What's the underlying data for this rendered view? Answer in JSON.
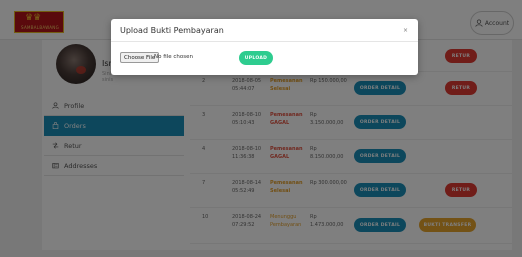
{
  "header": {
    "logo_text": "SAMBALBAWANG",
    "account_label": "Account"
  },
  "profile": {
    "name": "Isn",
    "meta_line1": "Sini",
    "meta_line2": "sinis"
  },
  "sidebar": {
    "items": [
      {
        "label": "Profile",
        "icon": "user-icon",
        "active": false
      },
      {
        "label": "Orders",
        "icon": "bag-icon",
        "active": true
      },
      {
        "label": "Retur",
        "icon": "return-icon",
        "active": false
      },
      {
        "label": "Addresses",
        "icon": "address-icon",
        "active": false
      }
    ]
  },
  "orders": {
    "rows": [
      {
        "no": "",
        "date": "",
        "status": "",
        "total": "",
        "detail": "",
        "action": "RETUR"
      },
      {
        "no": "2",
        "date": "2018-08-05 05:44:07",
        "status": "Pemesanan Selesai",
        "status_color": "orange",
        "total": "Rp 150.000,00",
        "detail": "ORDER DETAIL",
        "action": "RETUR"
      },
      {
        "no": "3",
        "date": "2018-08-10 05:10:43",
        "status": "Pemesanan GAGAL",
        "status_color": "red",
        "total": "Rp 3.150.000,00",
        "detail": "ORDER DETAIL",
        "action": ""
      },
      {
        "no": "4",
        "date": "2018-08-10 11:36:38",
        "status": "Pemesanan GAGAL",
        "status_color": "red",
        "total": "Rp 8.150.000,00",
        "detail": "ORDER DETAIL",
        "action": ""
      },
      {
        "no": "7",
        "date": "2018-08-14 05:52:49",
        "status": "Pemesanan Selesai",
        "status_color": "orange",
        "total": "Rp 300.000,00",
        "detail": "ORDER DETAIL",
        "action": "RETUR"
      },
      {
        "no": "10",
        "date": "2018-08-24 07:29:52",
        "status": "Menunggu Pembayaran",
        "status_color": "orange",
        "total": "Rp 1.473.000,00",
        "detail": "ORDER DETAIL",
        "action": "BUKTI TRANSFER"
      }
    ]
  },
  "modal": {
    "title": "Upload Bukti Pembayaran",
    "close": "×",
    "choose_file": "Choose File",
    "no_file": "No file chosen",
    "upload": "UPLOAD"
  },
  "colors": {
    "primary": "#1a8fb9",
    "danger": "#e03a32",
    "warning": "#e6a42c",
    "success": "#2ecc8f"
  }
}
